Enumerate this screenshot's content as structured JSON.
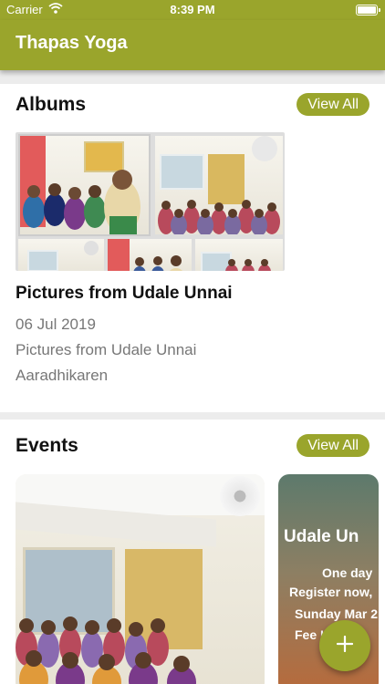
{
  "status_bar": {
    "carrier": "Carrier",
    "time": "8:39 PM",
    "icons": [
      "wifi-icon",
      "battery-icon"
    ]
  },
  "app_bar": {
    "title": "Thapas Yoga"
  },
  "colors": {
    "accent": "#9aa52c",
    "background": "#ececec",
    "card": "#ffffff",
    "meta_text": "#777777"
  },
  "albums": {
    "title": "Albums",
    "view_all_label": "View All",
    "album": {
      "title": "Pictures from Udale Unnai",
      "date": "06 Jul 2019",
      "description": "Pictures from Udale Unnai",
      "author": "Aaradhikaren"
    }
  },
  "events": {
    "title": "Events",
    "view_all_label": "View All",
    "cards": [
      {
        "name": "event-photo"
      },
      {
        "name": "event-poster",
        "poster_title": "Udale Un",
        "line1": "One day",
        "line2": "Register now,",
        "line3": "Sunday Mar 2",
        "line4": "Fee I"
      }
    ]
  },
  "fab": {
    "icon": "plus-icon"
  }
}
